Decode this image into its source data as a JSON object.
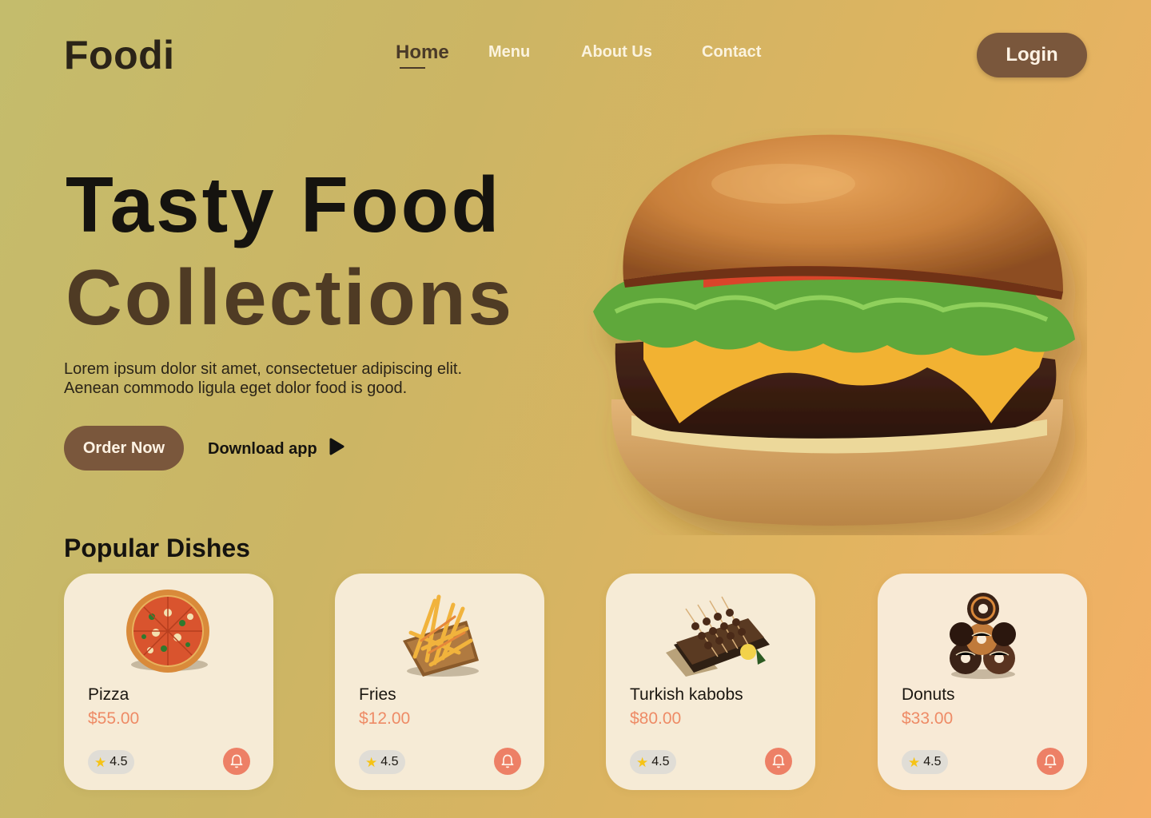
{
  "brand": {
    "logo": "Foodi"
  },
  "nav": {
    "items": [
      {
        "label": "Home",
        "active": true
      },
      {
        "label": "Menu",
        "active": false
      },
      {
        "label": "About Us",
        "active": false
      },
      {
        "label": "Contact",
        "active": false
      }
    ],
    "login_label": "Login"
  },
  "hero": {
    "title_line1": "Tasty Food",
    "title_line2": "Collections",
    "description": "Lorem ipsum dolor sit amet, consectetuer adipiscing elit. Aenean commodo ligula eget dolor food  is good.",
    "order_label": "Order Now",
    "download_label": "Download app",
    "image": "burger-image"
  },
  "popular": {
    "title": "Popular Dishes",
    "dishes": [
      {
        "name": "Pizza",
        "price": "$55.00",
        "rating": "4.5",
        "image": "pizza-image"
      },
      {
        "name": "Fries",
        "price": "$12.00",
        "rating": "4.5",
        "image": "fries-image"
      },
      {
        "name": "Turkish kabobs",
        "price": "$80.00",
        "rating": "4.5",
        "image": "kabobs-image"
      },
      {
        "name": "Donuts",
        "price": "$33.00",
        "rating": "4.5",
        "image": "donuts-image"
      }
    ]
  },
  "icons": {
    "play": "play-icon",
    "star": "star-icon",
    "bell": "bell-icon"
  },
  "colors": {
    "accent_brown": "#7a573c",
    "price_coral": "#ee8b66",
    "bell_coral": "#ed8066",
    "card_bg": "#f6ebd6",
    "star_yellow": "#f6c315"
  }
}
